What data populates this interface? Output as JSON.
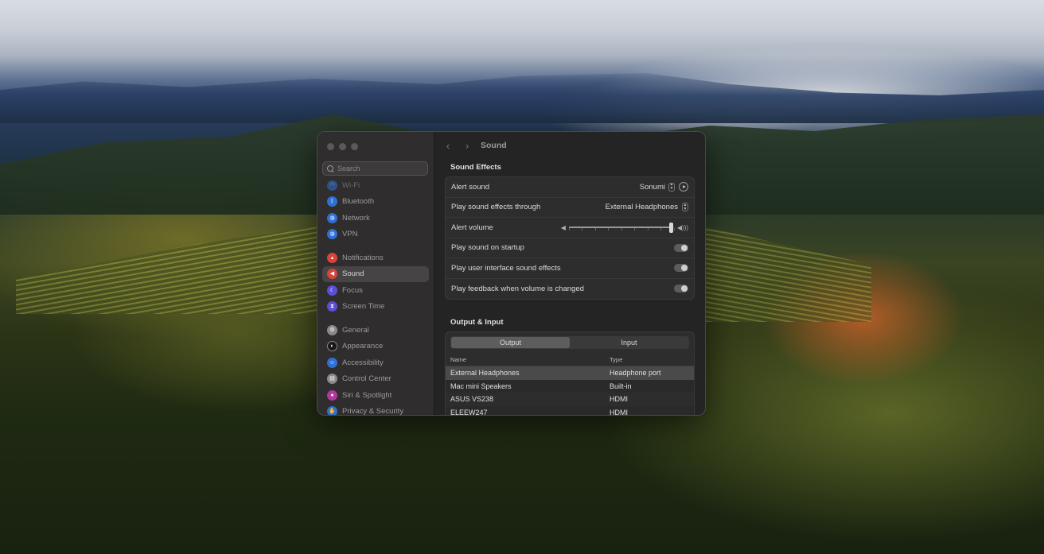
{
  "window": {
    "title": "Sound"
  },
  "sidebar": {
    "search_placeholder": "Search",
    "groups": [
      {
        "items": [
          {
            "label": "Wi-Fi",
            "icon": "wifi-icon",
            "color": "#2f6fd6"
          },
          {
            "label": "Bluetooth",
            "icon": "bluetooth-icon",
            "color": "#2f6fd6"
          },
          {
            "label": "Network",
            "icon": "globe-icon",
            "color": "#2f6fd6"
          },
          {
            "label": "VPN",
            "icon": "vpn-globe-icon",
            "color": "#2f6fd6"
          }
        ]
      },
      {
        "items": [
          {
            "label": "Notifications",
            "icon": "bell-icon",
            "color": "#d9433a"
          },
          {
            "label": "Sound",
            "icon": "speaker-icon",
            "color": "#d9433a",
            "active": true
          },
          {
            "label": "Focus",
            "icon": "moon-icon",
            "color": "#5b4fd6"
          },
          {
            "label": "Screen Time",
            "icon": "hourglass-icon",
            "color": "#5b4fd6"
          }
        ]
      },
      {
        "items": [
          {
            "label": "General",
            "icon": "gear-icon",
            "color": "#8a8a8a"
          },
          {
            "label": "Appearance",
            "icon": "appearance-icon",
            "color": "#1a1a1a"
          },
          {
            "label": "Accessibility",
            "icon": "accessibility-icon",
            "color": "#2f6fd6"
          },
          {
            "label": "Control Center",
            "icon": "control-center-icon",
            "color": "#8a8a8a"
          },
          {
            "label": "Siri & Spotlight",
            "icon": "siri-icon",
            "color": "#b2389e"
          },
          {
            "label": "Privacy & Security",
            "icon": "hand-icon",
            "color": "#2f6fd6"
          }
        ]
      }
    ]
  },
  "sound_effects": {
    "heading": "Sound Effects",
    "alert_sound": {
      "label": "Alert sound",
      "value": "Sonumi"
    },
    "play_through": {
      "label": "Play sound effects through",
      "value": "External Headphones"
    },
    "alert_volume": {
      "label": "Alert volume",
      "level_fraction": 0.97
    },
    "toggles": [
      {
        "label": "Play sound on startup",
        "on": true
      },
      {
        "label": "Play user interface sound effects",
        "on": true
      },
      {
        "label": "Play feedback when volume is changed",
        "on": true
      }
    ]
  },
  "output_input": {
    "heading": "Output & Input",
    "tabs": [
      {
        "label": "Output",
        "active": true
      },
      {
        "label": "Input",
        "active": false
      }
    ],
    "columns": [
      "Name",
      "Type"
    ],
    "rows": [
      {
        "name": "External Headphones",
        "type": "Headphone port",
        "selected": true
      },
      {
        "name": "Mac mini Speakers",
        "type": "Built-in"
      },
      {
        "name": "ASUS VS238",
        "type": "HDMI"
      },
      {
        "name": "ELEEW247",
        "type": "HDMI"
      }
    ]
  }
}
